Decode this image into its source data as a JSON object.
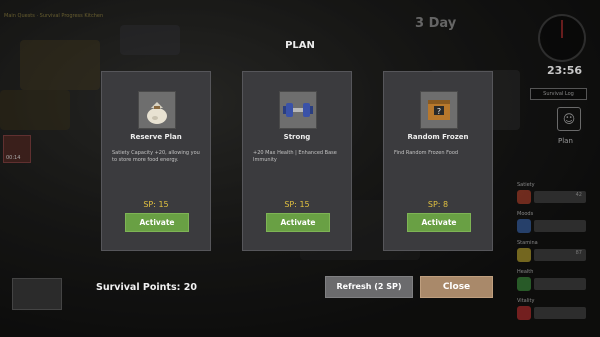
{
  "hud": {
    "top_left_text": "Main Quests · Survival Progress Kitchen",
    "day": "3 Day",
    "time": "23:56",
    "survival_log": "Survival Log",
    "plan_side_label": "Plan",
    "left_thumb_label": "00:14"
  },
  "stats": [
    {
      "label": "Satiety",
      "value": "42",
      "color": "#c0442c"
    },
    {
      "label": "Moods",
      "value": "",
      "color": "#3a6ab8"
    },
    {
      "label": "Stamina",
      "value": "87",
      "color": "#c8b030"
    },
    {
      "label": "Health",
      "value": "",
      "color": "#3f9a3f"
    },
    {
      "label": "Vitality",
      "value": "",
      "color": "#c83030"
    }
  ],
  "modal": {
    "title": "PLAN",
    "cards": [
      {
        "name": "Reserve Plan",
        "icon": "bag-icon",
        "description": "Satiety Capacity +20, allowing you to store more food energy.",
        "sp": "SP: 15",
        "button": "Activate"
      },
      {
        "name": "Strong",
        "icon": "dumbbell-icon",
        "description": "+20 Max Health | Enhanced Base Immunity",
        "sp": "SP: 15",
        "button": "Activate"
      },
      {
        "name": "Random Frozen",
        "icon": "crate-icon",
        "description": "Find Random Frozen Food",
        "sp": "SP: 8",
        "button": "Activate"
      }
    ],
    "survival_points": "Survival Points:  20",
    "refresh_label": "Refresh (2 SP)",
    "close_label": "Close"
  }
}
